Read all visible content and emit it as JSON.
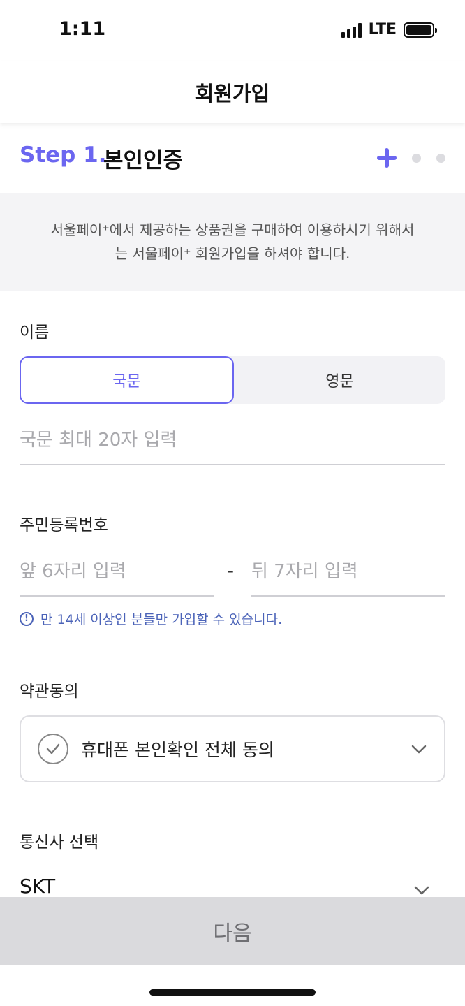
{
  "status_bar": {
    "time": "1:11",
    "network": "LTE"
  },
  "header": {
    "title": "회원가입"
  },
  "step": {
    "number": "Step 1.",
    "title": "본인인증",
    "total_steps": 3,
    "current_step": 1
  },
  "notice": {
    "line1": "서울페이⁺에서 제공하는 상품권을 구매하여 이용하시기 위해서",
    "line2": "는 서울페이⁺ 회원가입을 하셔야 합니다."
  },
  "name_section": {
    "label": "이름",
    "tabs": [
      {
        "label": "국문",
        "active": true
      },
      {
        "label": "영문",
        "active": false
      }
    ],
    "input_placeholder": "국문 최대 20자 입력"
  },
  "resident_section": {
    "label": "주민등록번호",
    "front_placeholder": "앞 6자리 입력",
    "separator": "-",
    "back_placeholder": "뒤 7자리 입력",
    "hint": "만 14세 이상인 분들만 가입할 수 있습니다."
  },
  "terms_section": {
    "label": "약관동의",
    "agree_all": "휴대폰 본인확인 전체 동의"
  },
  "carrier_section": {
    "label": "통신사 선택",
    "selected": "SKT"
  },
  "next_button": {
    "label": "다음"
  },
  "colors": {
    "accent": "#6b66f0",
    "hint": "#4b63b8",
    "disabled": "#dadadd"
  }
}
